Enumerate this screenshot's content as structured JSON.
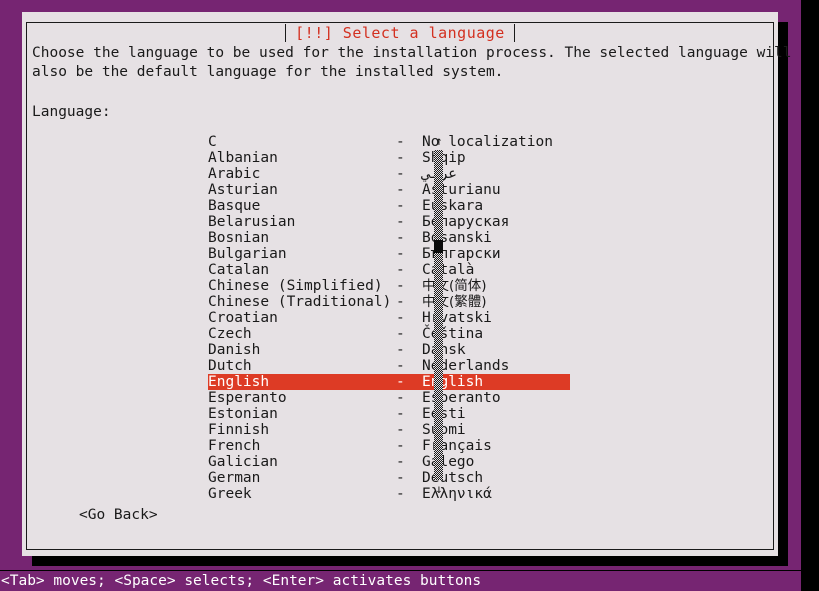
{
  "dialog": {
    "title": "[!!] Select a language",
    "intro_line1": "Choose the language to be used for the installation process. The selected language will",
    "intro_line2": "also be the default language for the installed system.",
    "field_label": "Language:",
    "go_back_label": "<Go Back>",
    "title_color": "#d33020",
    "selection_color": "#dd3b25",
    "background_color": "#e6e1e4",
    "backdrop_color": "#762572"
  },
  "scrollbar": {
    "up_arrow": "↑",
    "down_arrow": "↓"
  },
  "languages": [
    {
      "name": "C",
      "dash": "-",
      "native": "No localization",
      "selected": false,
      "cjk": false
    },
    {
      "name": "Albanian",
      "dash": "-",
      "native": "Shqip",
      "selected": false,
      "cjk": false
    },
    {
      "name": "Arabic",
      "dash": "-",
      "native": "عربي",
      "selected": false,
      "cjk": false
    },
    {
      "name": "Asturian",
      "dash": "-",
      "native": "Asturianu",
      "selected": false,
      "cjk": false
    },
    {
      "name": "Basque",
      "dash": "-",
      "native": "Euskara",
      "selected": false,
      "cjk": false
    },
    {
      "name": "Belarusian",
      "dash": "-",
      "native": "Беларуская",
      "selected": false,
      "cjk": false
    },
    {
      "name": "Bosnian",
      "dash": "-",
      "native": "Bosanski",
      "selected": false,
      "cjk": false
    },
    {
      "name": "Bulgarian",
      "dash": "-",
      "native": "Български",
      "selected": false,
      "cjk": false
    },
    {
      "name": "Catalan",
      "dash": "-",
      "native": "Català",
      "selected": false,
      "cjk": false
    },
    {
      "name": "Chinese (Simplified)",
      "dash": "-",
      "native": "中文(简体)",
      "selected": false,
      "cjk": true
    },
    {
      "name": "Chinese (Traditional)",
      "dash": "-",
      "native": "中文(繁體)",
      "selected": false,
      "cjk": true
    },
    {
      "name": "Croatian",
      "dash": "-",
      "native": "Hrvatski",
      "selected": false,
      "cjk": false
    },
    {
      "name": "Czech",
      "dash": "-",
      "native": "Čeština",
      "selected": false,
      "cjk": false
    },
    {
      "name": "Danish",
      "dash": "-",
      "native": "Dansk",
      "selected": false,
      "cjk": false
    },
    {
      "name": "Dutch",
      "dash": "-",
      "native": "Nederlands",
      "selected": false,
      "cjk": false
    },
    {
      "name": "English",
      "dash": "-",
      "native": "English",
      "selected": true,
      "cjk": false
    },
    {
      "name": "Esperanto",
      "dash": "-",
      "native": "Esperanto",
      "selected": false,
      "cjk": false
    },
    {
      "name": "Estonian",
      "dash": "-",
      "native": "Eesti",
      "selected": false,
      "cjk": false
    },
    {
      "name": "Finnish",
      "dash": "-",
      "native": "Suomi",
      "selected": false,
      "cjk": false
    },
    {
      "name": "French",
      "dash": "-",
      "native": "Français",
      "selected": false,
      "cjk": false
    },
    {
      "name": "Galician",
      "dash": "-",
      "native": "Galego",
      "selected": false,
      "cjk": false
    },
    {
      "name": "German",
      "dash": "-",
      "native": "Deutsch",
      "selected": false,
      "cjk": false
    },
    {
      "name": "Greek",
      "dash": "-",
      "native": "Ελληνικά",
      "selected": false,
      "cjk": false
    }
  ],
  "statusbar": {
    "hint": "<Tab> moves; <Space> selects; <Enter> activates buttons"
  }
}
